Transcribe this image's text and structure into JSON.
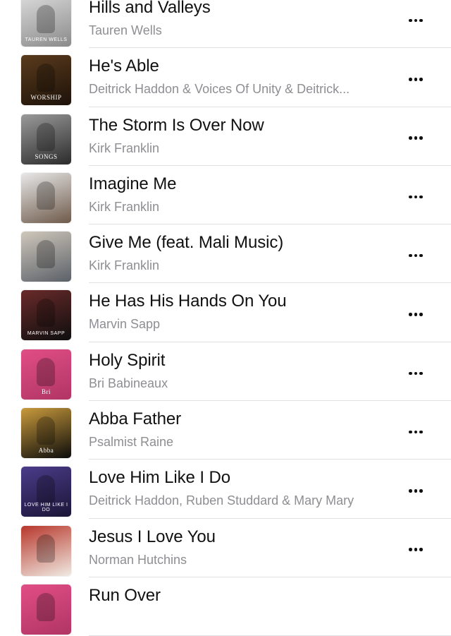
{
  "songs": [
    {
      "title": "Hills and Valleys",
      "artist": "Tauren Wells",
      "art_text": "TAUREN WELLS",
      "colors": [
        "#d9d9d9",
        "#8a8a8a"
      ]
    },
    {
      "title": "He's Able",
      "artist": "Deitrick Haddon & Voices Of Unity & Deitrick...",
      "art_text": "WORSHIP",
      "colors": [
        "#5a3b1c",
        "#1d120a"
      ]
    },
    {
      "title": "The Storm Is Over Now",
      "artist": "Kirk Franklin",
      "art_text": "SONGS",
      "colors": [
        "#9a9a9a",
        "#2b2b2b"
      ]
    },
    {
      "title": "Imagine Me",
      "artist": "Kirk Franklin",
      "art_text": "",
      "colors": [
        "#e8e8e8",
        "#6e5a4a"
      ]
    },
    {
      "title": "Give Me (feat. Mali Music)",
      "artist": "Kirk Franklin",
      "art_text": "",
      "colors": [
        "#cfc7bb",
        "#5b6168"
      ]
    },
    {
      "title": "He Has His Hands On You",
      "artist": "Marvin Sapp",
      "art_text": "MARVIN SAPP",
      "colors": [
        "#6a2a2a",
        "#0e0e0e"
      ]
    },
    {
      "title": "Holy Spirit",
      "artist": "Bri Babineaux",
      "art_text": "Bri",
      "colors": [
        "#e14e86",
        "#b03564"
      ]
    },
    {
      "title": "Abba Father",
      "artist": "Psalmist Raine",
      "art_text": "Abba",
      "colors": [
        "#c99a3c",
        "#0c0c0c"
      ]
    },
    {
      "title": "Love Him Like I Do",
      "artist": "Deitrick Haddon, Ruben Studdard & Mary Mary",
      "art_text": "LOVE HIM LIKE I DO",
      "colors": [
        "#4b3c8a",
        "#1b1536"
      ]
    },
    {
      "title": "Jesus I Love You",
      "artist": "Norman Hutchins",
      "art_text": "",
      "colors": [
        "#b8372c",
        "#efeae2"
      ]
    },
    {
      "title": "Run Over",
      "artist": "",
      "art_text": "",
      "colors": [
        "#e14e86",
        "#b03564"
      ]
    }
  ],
  "icons": {
    "more": "more-ellipsis-icon",
    "artwork": "album-artwork"
  }
}
